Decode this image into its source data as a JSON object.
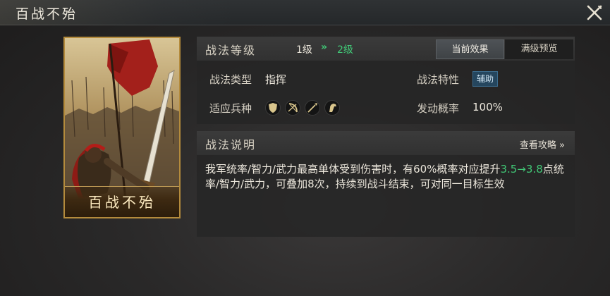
{
  "window": {
    "title": "百战不殆",
    "close_icon": "close-x-icon"
  },
  "card": {
    "name": "百战不殆"
  },
  "level": {
    "label": "战法等级",
    "current": "1级",
    "arrow": "»",
    "next": "2级"
  },
  "tabs": [
    {
      "label": "当前效果",
      "selected": true
    },
    {
      "label": "满级预览",
      "selected": false
    }
  ],
  "attributes": {
    "type_label": "战法类型",
    "type_value": "指挥",
    "trait_label": "战法特性",
    "trait_value": "辅助",
    "troops_label": "适应兵种",
    "troops_icons": [
      "shield-icon",
      "bow-icon",
      "spear-icon",
      "horse-icon"
    ],
    "rate_label": "发动概率",
    "rate_value": "100%"
  },
  "description": {
    "title": "战法说明",
    "guide_link": "查看攻略 »",
    "text_before": "我军统率/智力/武力最高单体受到伤害时，有60%概率对应提升",
    "highlight": "3.5→3.8",
    "text_after": "点统率/智力/武力，可叠加8次，持续到战斗结束，可对同一目标生效"
  },
  "colors": {
    "accent_green": "#41c776",
    "card_gold": "#b48b3c",
    "badge_blue": "#25465e"
  }
}
